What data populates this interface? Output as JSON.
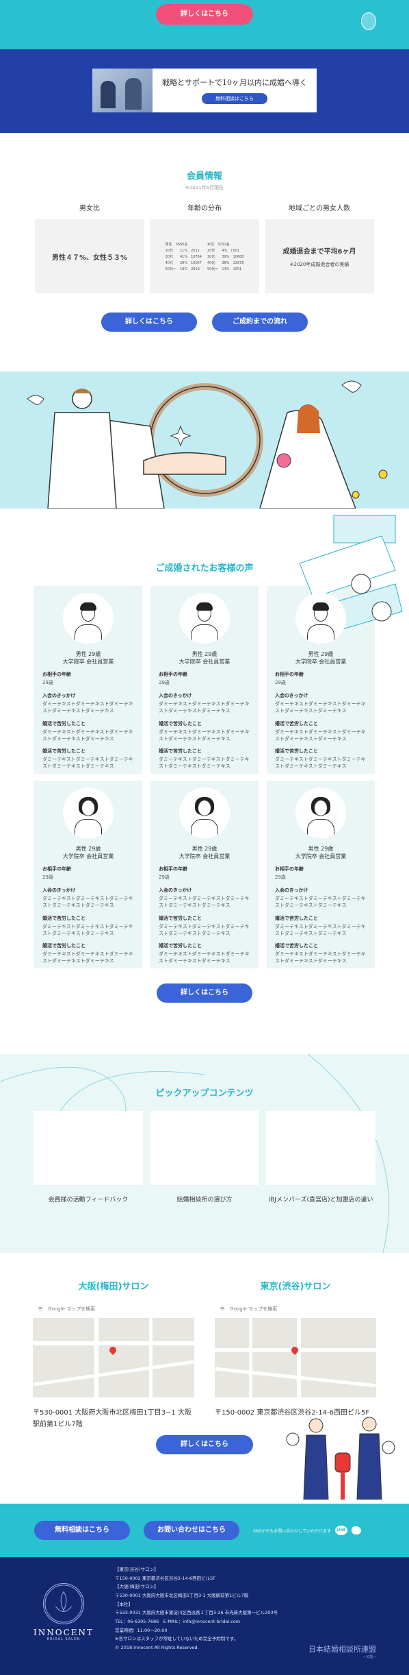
{
  "top": {
    "button": "詳しくはこちら"
  },
  "banner": {
    "headline": "戦略とサポートで10ヶ月以内に成婚へ導く",
    "button": "無料相談はこちら"
  },
  "members": {
    "title": "会員情報",
    "subtitle": "※2021年6月現在",
    "col1": {
      "heading": "男女比",
      "value": "男性４７%、女性５３%"
    },
    "col2": {
      "heading": "年齢の分布",
      "male_head": "男性　3660名",
      "female_head": "女性　3231名",
      "male_rows": [
        "20代　　11%　2011",
        "30代　　41%　10764",
        "40代　　28%　10057",
        "50代〜　19%　2819"
      ],
      "female_rows": [
        "20代　　4%　1501",
        "30代　　39%　10688",
        "40代　　38%　12978",
        "50代〜　13%　1051"
      ]
    },
    "col3": {
      "heading": "地域ごとの男女人数",
      "value": "成婚退会まで平均6ヶ月",
      "note": "※2020年成婚退会者の実績"
    },
    "btn_detail": "詳しくはこちら",
    "btn_flow": "ご成約までの流れ"
  },
  "testimonials": {
    "title": "ご成婚されたお客様の声",
    "more": "詳しくはこちら",
    "cards": [
      {
        "who": "男性 29歳",
        "job": "大学院卒 会社員営業",
        "l1": "お相手の年齢",
        "v1": "29歳",
        "l2": "入会のきっかけ",
        "v2": "ダミーテキストダミーテキストダミーテキストダミーテキストダミーテキス",
        "l3": "婚活で苦労したこと",
        "v3": "ダミーテキストダミーテキストダミーテキストダミーテキストダミーテキス",
        "l4": "婚活で苦労したこと",
        "v4": "ダミーテキストダミーテキストダミーテキストダミーテキストダミーテキス"
      },
      {
        "who": "男性 29歳",
        "job": "大学院卒 会社員営業",
        "l1": "お相手の年齢",
        "v1": "29歳",
        "l2": "入会のきっかけ",
        "v2": "ダミーテキストダミーテキストダミーテキストダミーテキストダミーテキス",
        "l3": "婚活で苦労したこと",
        "v3": "ダミーテキストダミーテキストダミーテキストダミーテキストダミーテキス",
        "l4": "婚活で苦労したこと",
        "v4": "ダミーテキストダミーテキストダミーテキストダミーテキストダミーテキス"
      },
      {
        "who": "男性 29歳",
        "job": "大学院卒 会社員営業",
        "l1": "お相手の年齢",
        "v1": "29歳",
        "l2": "入会のきっかけ",
        "v2": "ダミーテキストダミーテキストダミーテキストダミーテキストダミーテキス",
        "l3": "婚活で苦労したこと",
        "v3": "ダミーテキストダミーテキストダミーテキストダミーテキストダミーテキス",
        "l4": "婚活で苦労したこと",
        "v4": "ダミーテキストダミーテキストダミーテキストダミーテキストダミーテキス"
      },
      {
        "who": "男性 29歳",
        "job": "大学院卒 会社員営業",
        "l1": "お相手の年齢",
        "v1": "29歳",
        "l2": "入会のきっかけ",
        "v2": "ダミーテキストダミーテキストダミーテキストダミーテキストダミーテキス",
        "l3": "婚活で苦労したこと",
        "v3": "ダミーテキストダミーテキストダミーテキストダミーテキストダミーテキス",
        "l4": "婚活で苦労したこと",
        "v4": "ダミーテキストダミーテキストダミーテキストダミーテキストダミーテキス"
      },
      {
        "who": "男性 29歳",
        "job": "大学院卒 会社員営業",
        "l1": "お相手の年齢",
        "v1": "29歳",
        "l2": "入会のきっかけ",
        "v2": "ダミーテキストダミーテキストダミーテキストダミーテキストダミーテキス",
        "l3": "婚活で苦労したこと",
        "v3": "ダミーテキストダミーテキストダミーテキストダミーテキストダミーテキス",
        "l4": "婚活で苦労したこと",
        "v4": "ダミーテキストダミーテキストダミーテキストダミーテキストダミーテキス"
      },
      {
        "who": "男性 29歳",
        "job": "大学院卒 会社員営業",
        "l1": "お相手の年齢",
        "v1": "29歳",
        "l2": "入会のきっかけ",
        "v2": "ダミーテキストダミーテキストダミーテキストダミーテキストダミーテキス",
        "l3": "婚活で苦労したこと",
        "v3": "ダミーテキストダミーテキストダミーテキストダミーテキストダミーテキス",
        "l4": "婚活で苦労したこと",
        "v4": "ダミーテキストダミーテキストダミーテキストダミーテキストダミーテキス"
      }
    ]
  },
  "pickup": {
    "title": "ピックアップコンテンツ",
    "items": [
      "会員様の活動フィードバック",
      "結婚相談所の選び方",
      "IBJメンバーズ(直営店)と加盟店の違い"
    ]
  },
  "salons": {
    "osaka": {
      "title": "大阪(梅田)サロン",
      "address": "〒530-0001 大阪府大阪市北区梅田1丁目3−1 大阪駅前第1ビル7階"
    },
    "tokyo": {
      "title": "東京(渋谷)サロン",
      "address": "〒150-0002 東京都渋谷区渋谷2-14-6西田ビル5F"
    },
    "map_search": "Google マップを検索",
    "more": "詳しくはこちら"
  },
  "cta": {
    "free": "無料相談はこちら",
    "contact": "お問い合わせはこちら",
    "sns": "SNSからもお問い合わせしていただけます",
    "line": "LINE"
  },
  "footer": {
    "logo_name": "INNOCENT",
    "logo_sub": "BRIDAL SALON",
    "lines": [
      "【東京(渋谷)サロン】",
      "〒150-0002 東京都渋谷区渋谷2-14-6西田ビル5F",
      "【大阪(梅田)サロン】",
      "〒530-0001 大阪府大阪市北区梅田1丁目3-1 大阪駅前第1ビル7階",
      "【本社】",
      "〒533-0031 大阪府大阪市東淀川区西淡路１丁目3-26 市光新大阪第一ビル203号",
      "TEL：06-6305-7686　E-MAIL：info@innocent-bridal.com",
      "営業時間：11:00〜20:00",
      "※各サロンはスタッフが常駐していないため完全予約制です。",
      "© 2018 Innocent All Rights Reserved."
    ],
    "renmei": "日本結婚相談所連盟",
    "renmei_sub": "─ 公認 ─"
  },
  "colors": {
    "teal": "#29c0cf",
    "navy": "#13276f",
    "blue": "#3a64d8",
    "pink": "#f0507a"
  }
}
